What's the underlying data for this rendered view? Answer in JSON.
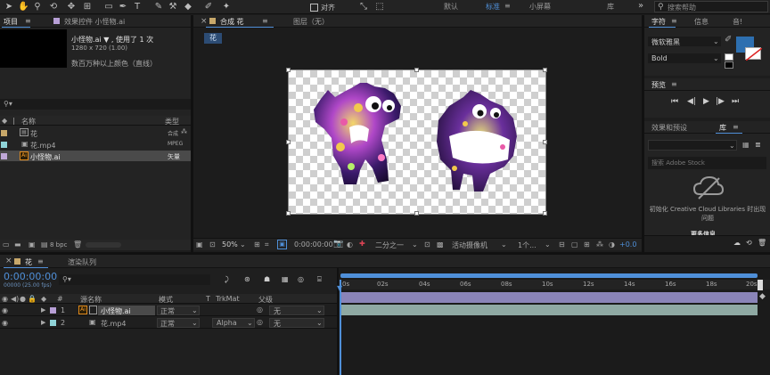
{
  "toolbar": {
    "snap_label": "对齐",
    "workspaces": [
      "默认",
      "标准",
      "小屏幕",
      "库"
    ],
    "active_workspace": "标准",
    "search_placeholder": "搜索帮助"
  },
  "project": {
    "tab_label": "项目",
    "effects_tab": "效果控件 小怪物.ai",
    "item_name": "小怪物.ai ▼ , 使用了 1 次",
    "item_dims": "1280 x 720 (1.00)",
    "item_colors": "数百万种以上颜色（直线）",
    "col_name": "名称",
    "col_type": "类型",
    "items": [
      {
        "name": "花",
        "type": "合成",
        "color": "#c8a86a"
      },
      {
        "name": "花.mp4",
        "type": "MPEG",
        "color": "#8fd3d8"
      },
      {
        "name": "小怪物.ai",
        "type": "矢量",
        "color": "#c0a8d8"
      }
    ],
    "bpc": "8 bpc"
  },
  "composition": {
    "tab_label": "合成 花",
    "layer_tab": "图层（无）",
    "crumb": "花",
    "zoom": "50%",
    "timecode": "0:00:00:00",
    "resolution": "二分之一",
    "camera": "活动摄像机",
    "views": "1个...",
    "exposure": "+0.0"
  },
  "character": {
    "tab_label": "字符",
    "info_tab": "信息",
    "audio_tab": "音!",
    "font_name": "微软雅黑",
    "font_style": "Bold",
    "fill_color": "#2d6fb0"
  },
  "preview": {
    "tab_label": "预览"
  },
  "library": {
    "effects_tab": "效果和预设",
    "lib_tab": "库",
    "stock_placeholder": "搜索 Adobe Stock",
    "message": "初始化 Creative Cloud Libraries 时出现问题",
    "footer": "更多信息"
  },
  "timeline": {
    "comp_tab": "花",
    "render_tab": "渲染队列",
    "timecode": "0:00:00:00",
    "frame_info": "00000 (25.00 fps)",
    "headers": {
      "num": "#",
      "source": "源名称",
      "mode": "模式",
      "t": "T",
      "trkmat": "TrkMat",
      "parent": "父级"
    },
    "layers": [
      {
        "num": "1",
        "name": "小怪物.ai",
        "mode": "正常",
        "trkmat": "",
        "parent": "无",
        "color": "#b79fd6",
        "bar": "#8a84b8"
      },
      {
        "num": "2",
        "name": "花.mp4",
        "mode": "正常",
        "trkmat": "Alpha",
        "parent": "无",
        "color": "#8fd3d8",
        "bar": "#8fa9a3"
      }
    ],
    "ruler": [
      "0s",
      "02s",
      "04s",
      "06s",
      "08s",
      "10s",
      "12s",
      "14s",
      "16s",
      "18s",
      "20s"
    ]
  }
}
